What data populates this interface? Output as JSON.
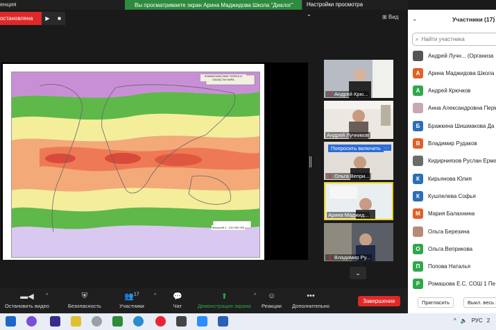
{
  "titlebar": {
    "title": "енция"
  },
  "share_banner": {
    "text": "Вы просматриваете экран Арина Маджидова Школа \"Диалог\"",
    "view_options": "Настройки просмотра ⌄"
  },
  "paused": {
    "label": "остановлена",
    "play": "▶",
    "stop": "■"
  },
  "view_button": "⊞ Вид",
  "map": {
    "caption": "КЛИМАТИЧЕСКИЕ ПОЯСА И ОБЛАСТИ МИРА",
    "scale": "Масштаб 1 : 120 000 000"
  },
  "tiles": [
    {
      "name": "Андрей Крю...",
      "muted": true
    },
    {
      "name": "Андрей Лучников",
      "muted": false
    },
    {
      "name": "Ольга Вепри...",
      "muted": true,
      "ask_button": "Попросить включить",
      "more": "···"
    },
    {
      "name": "Арина Маджид...",
      "muted": false
    },
    {
      "name": "Владимир Ру...",
      "muted": true
    }
  ],
  "scroll_down": "⌄",
  "panel": {
    "title": "Участники (17)",
    "search_placeholder": "Найти участника",
    "participants": [
      {
        "initial": "",
        "name": "Андрей Лучн...  (Организа",
        "color": "#555555"
      },
      {
        "initial": "А",
        "name": "Арина Маджидова Школа",
        "color": "#e0612a"
      },
      {
        "initial": "А",
        "name": "Андрей Крючков",
        "color": "#2ea84a"
      },
      {
        "initial": "",
        "name": "Анна Александровна Перм",
        "color": "#c9a6b0"
      },
      {
        "initial": "Б",
        "name": "Бражкина Шишмакова Да",
        "color": "#2b6fb8"
      },
      {
        "initial": "В",
        "name": "Владимир Рудаков",
        "color": "#e0612a"
      },
      {
        "initial": "",
        "name": "Кидирниязов Руслан Ерма",
        "color": "#6b6b6b"
      },
      {
        "initial": "К",
        "name": "Кирьянова Юлия",
        "color": "#2b6fb8"
      },
      {
        "initial": "К",
        "name": "Кушпелева Софья",
        "color": "#2b6fb8"
      },
      {
        "initial": "М",
        "name": "Мария Балахнина",
        "color": "#e0612a"
      },
      {
        "initial": "",
        "name": "Ольга Березина",
        "color": "#b88a7a"
      },
      {
        "initial": "О",
        "name": "Ольга Веприкова",
        "color": "#2ea84a"
      },
      {
        "initial": "П",
        "name": "Попова Наталья",
        "color": "#2ea84a"
      },
      {
        "initial": "Р",
        "name": "Ромашова Е.С. СОШ 1 Пе",
        "color": "#2ea84a"
      }
    ],
    "invite": "Пригласить",
    "mute_all": "Выкл. весь з"
  },
  "toolbar": {
    "stop_video": "Остановить видео",
    "security": "Безопасность",
    "participants": "Участники",
    "participants_count": "17",
    "chat": "Чат",
    "share_screen": "Демонстрация экрана",
    "reactions": "Реакции",
    "more": "Дополнительно",
    "end": "Завершение"
  },
  "tray": {
    "lang": "РУС",
    "time": "2"
  }
}
